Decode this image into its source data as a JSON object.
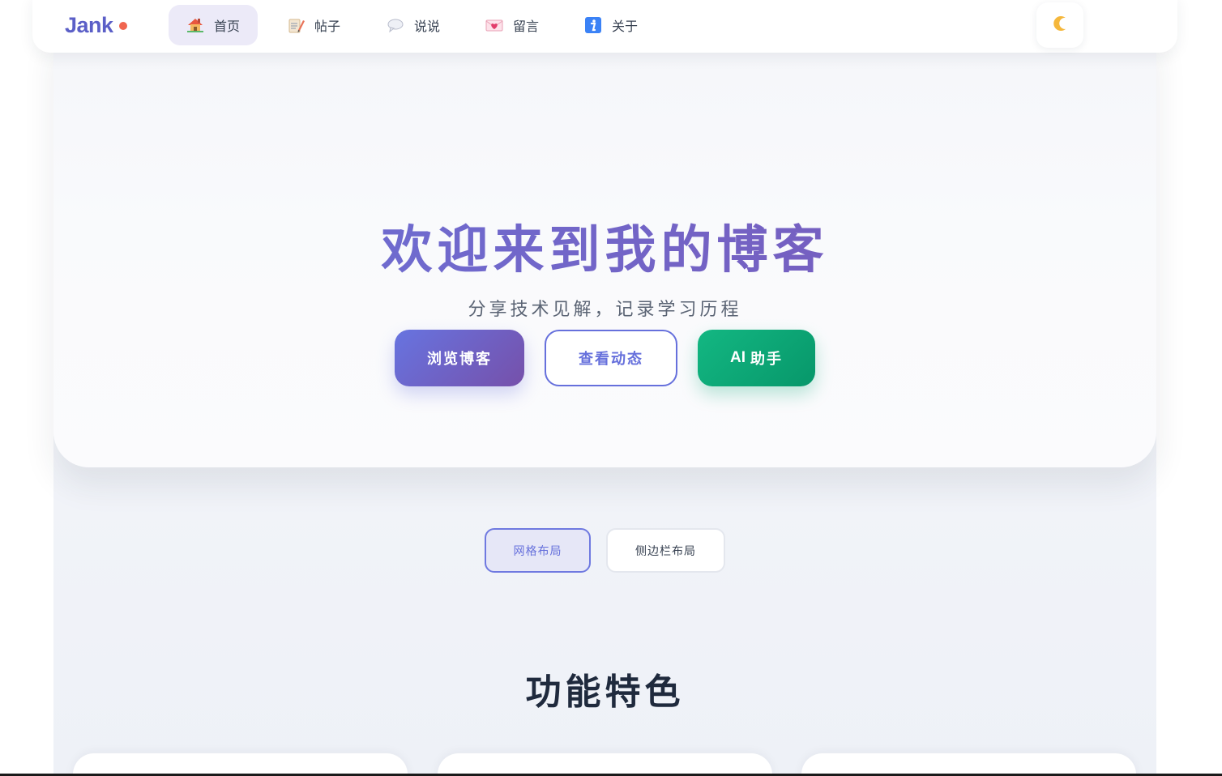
{
  "navbar": {
    "logo": "Jank",
    "items": [
      {
        "label": "首页",
        "icon": "house-icon",
        "active": true
      },
      {
        "label": "帖子",
        "icon": "memo-icon",
        "active": false
      },
      {
        "label": "说说",
        "icon": "speech-bubble-icon",
        "active": false
      },
      {
        "label": "留言",
        "icon": "love-letter-icon",
        "active": false
      },
      {
        "label": "关于",
        "icon": "info-icon",
        "active": false
      }
    ],
    "theme_toggle_icon": "moon-icon",
    "user_status": "online"
  },
  "hero": {
    "title": "欢迎来到我的博客",
    "subtitle": "分享技术见解，记录学习历程",
    "buttons": {
      "browse": "浏览博客",
      "moments": "查看动态",
      "ai_prefix": "AI",
      "ai_suffix": "助手"
    }
  },
  "layout_toggle": {
    "grid": "网格布局",
    "sidebar": "侧边栏布局",
    "selected": "grid"
  },
  "features": {
    "title": "功能特色"
  },
  "colors": {
    "accent": "#6670dc",
    "accent_purple": "#7650aa",
    "green": "#0ea06a",
    "logo_dot": "#f0654f"
  }
}
